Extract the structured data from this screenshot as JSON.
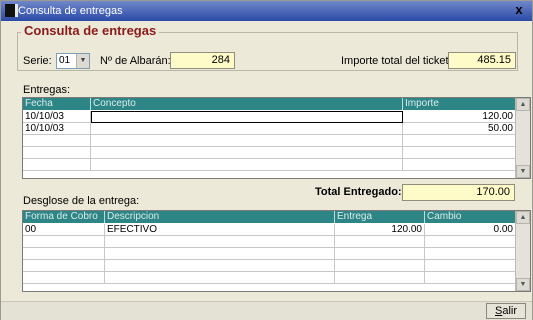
{
  "window": {
    "title": "Consulta de entregas",
    "close_label": "x"
  },
  "group_title": "Consulta de entregas",
  "serie": {
    "label": "Serie:",
    "value": "01"
  },
  "albaran": {
    "label": "Nº de Albarán:",
    "value": "284"
  },
  "importe_total": {
    "label": "Importe total del ticket:",
    "value": "485.15"
  },
  "entregas": {
    "label": "Entregas:",
    "columns": [
      "Fecha",
      "Concepto",
      "Importe"
    ],
    "rows": [
      {
        "fecha": "10/10/03",
        "concepto": "",
        "importe": "120.00"
      },
      {
        "fecha": "10/10/03",
        "concepto": "",
        "importe": "50.00"
      }
    ]
  },
  "total_entregado": {
    "label": "Total Entregado:",
    "value": "170.00"
  },
  "desglose": {
    "label": "Desglose de la entrega:",
    "columns": [
      "Forma de Cobro",
      "Descripcion",
      "Entrega",
      "Cambio"
    ],
    "rows": [
      {
        "forma": "00",
        "descripcion": "EFECTIVO",
        "entrega": "120.00",
        "cambio": "0.00"
      }
    ]
  },
  "buttons": {
    "salir_first": "S",
    "salir_rest": "alir"
  }
}
